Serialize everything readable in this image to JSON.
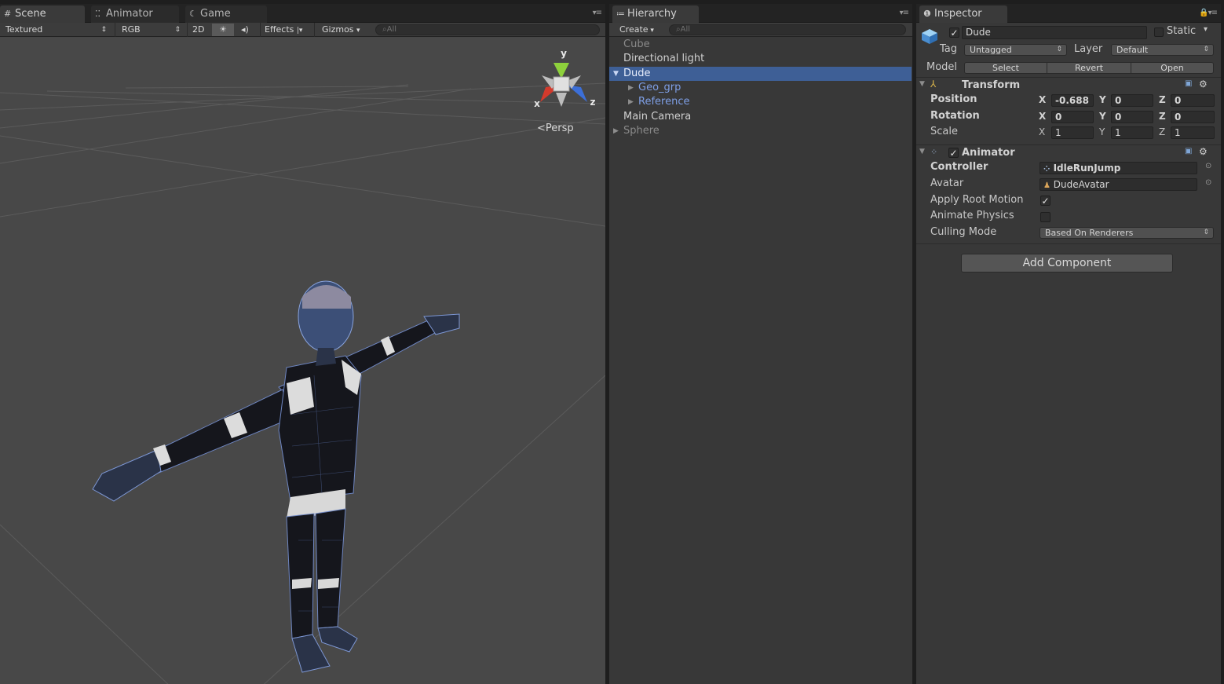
{
  "scene": {
    "tabs": [
      {
        "label": "Scene",
        "icon": "grid-icon"
      },
      {
        "label": "Animator",
        "icon": "animator-icon"
      },
      {
        "label": "Game",
        "icon": "game-icon"
      }
    ],
    "toolbar": {
      "shading": "Textured",
      "render_mode": "RGB",
      "mode_2d": "2D",
      "lighting_icon": "sun-icon",
      "audio_icon": "speaker-icon",
      "effects": "Effects",
      "gizmos": "Gizmos",
      "search_placeholder": "All"
    },
    "gizmo": {
      "y": "y",
      "x": "x",
      "z": "z",
      "projection": "Persp"
    }
  },
  "hierarchy": {
    "tab": "Hierarchy",
    "create": "Create",
    "search_placeholder": "All",
    "items": [
      {
        "label": "Cube",
        "indent": 0,
        "expand": "",
        "style": "dim"
      },
      {
        "label": "Directional light",
        "indent": 0,
        "expand": "",
        "style": "normal"
      },
      {
        "label": "Dude",
        "indent": 0,
        "expand": "open",
        "style": "selected"
      },
      {
        "label": "Geo_grp",
        "indent": 1,
        "expand": "closed",
        "style": "blue"
      },
      {
        "label": "Reference",
        "indent": 1,
        "expand": "closed",
        "style": "blue"
      },
      {
        "label": "Main Camera",
        "indent": 0,
        "expand": "",
        "style": "normal"
      },
      {
        "label": "Sphere",
        "indent": 0,
        "expand": "closed",
        "style": "dim"
      }
    ]
  },
  "inspector": {
    "tab": "Inspector",
    "object": {
      "name": "Dude",
      "active": true,
      "static_label": "Static",
      "tag_label": "Tag",
      "tag_value": "Untagged",
      "layer_label": "Layer",
      "layer_value": "Default",
      "model_label": "Model",
      "model_buttons": [
        "Select",
        "Revert",
        "Open"
      ]
    },
    "transform": {
      "title": "Transform",
      "rows": [
        {
          "label": "Position",
          "x": "-0.688",
          "y": "0",
          "z": "0"
        },
        {
          "label": "Rotation",
          "x": "0",
          "y": "0",
          "z": "0"
        },
        {
          "label": "Scale",
          "x": "1",
          "y": "1",
          "z": "1"
        }
      ]
    },
    "animator": {
      "title": "Animator",
      "enabled": true,
      "controller_label": "Controller",
      "controller_value": "IdleRunJump",
      "avatar_label": "Avatar",
      "avatar_value": "DudeAvatar",
      "apply_root_motion_label": "Apply Root Motion",
      "apply_root_motion": true,
      "animate_physics_label": "Animate Physics",
      "animate_physics": false,
      "culling_label": "Culling Mode",
      "culling_value": "Based On Renderers"
    },
    "add_component": "Add Component"
  },
  "colors": {
    "selection": "#3e5f96",
    "prefab_blue": "#7e9fe6",
    "gizmo_y": "#8ed13c",
    "gizmo_x": "#d33a2c",
    "gizmo_z": "#3c6fd8"
  }
}
